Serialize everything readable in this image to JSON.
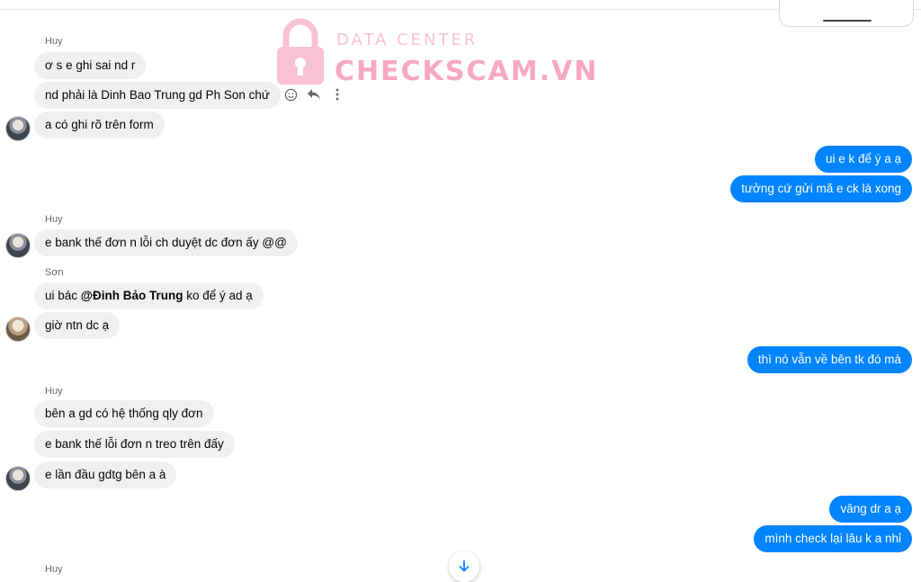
{
  "watermark": {
    "line1": "DATA CENTER",
    "line2": "CHECKSCAM.VN"
  },
  "colors": {
    "outgoing_bubble": "#0084ff",
    "incoming_bubble": "#f0f0f0",
    "watermark": "#f06292"
  },
  "messages": {
    "s1": "Huy",
    "m1": "ơ s e ghi sai nd r",
    "m2": "nd phải là Dinh Bao Trung gd Ph Son chứ",
    "m3": "a có ghi rõ trên form",
    "o1": "ui e k để ý a ạ",
    "o2": "tưởng cứ gửi mã e ck là xong",
    "s2": "Huy",
    "m4": "e bank thế đơn n lỗi ch duyệt dc đơn ấy @@",
    "s3": "Sơn",
    "m5_prefix": "ui bác ",
    "m5_mention": "@Đinh Bảo Trung",
    "m5_suffix": " ko để ý ad ạ",
    "m6": "giờ ntn dc ạ",
    "o3": "thì nó vẫn về bên tk đó mà",
    "s4": "Huy",
    "m7": "bên a gd có hệ thống qly đơn",
    "m8": "e bank thế lỗi đơn n treo trên đấy",
    "m9": "e lần đầu gdtg bên a à",
    "o4": "vâng dr a ạ",
    "o5": "mình check lại lâu k a nhỉ",
    "s5": "Huy"
  },
  "icons": {
    "react": "smiley-icon",
    "reply": "reply-icon",
    "more": "more-icon",
    "scroll": "arrow-down-icon"
  }
}
